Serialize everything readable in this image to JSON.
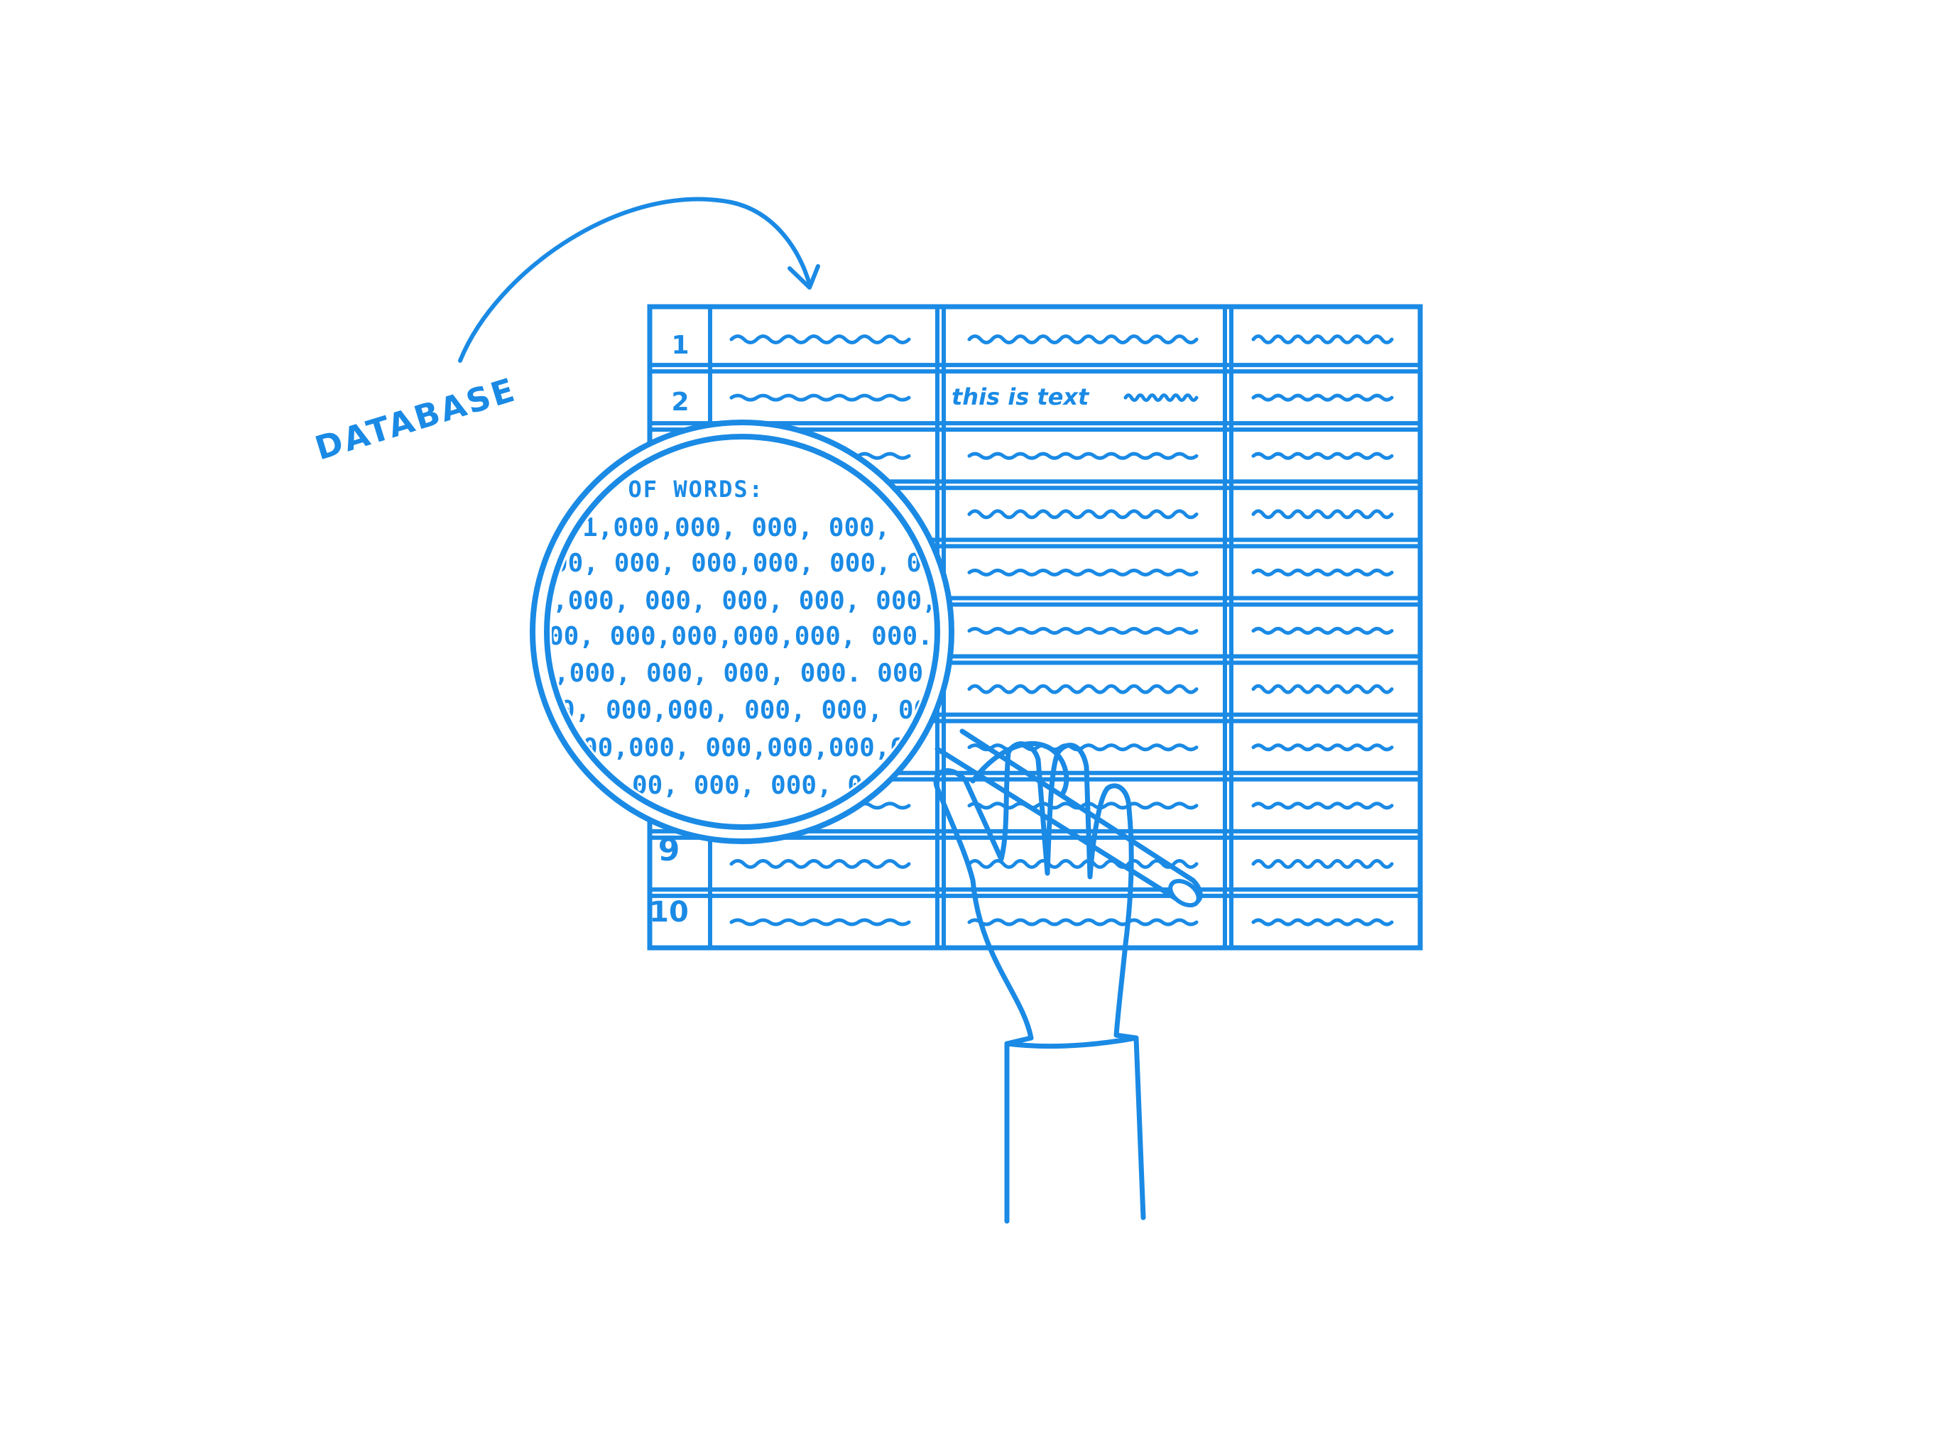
{
  "illustration": {
    "label": "DATABASE",
    "ink_color": "#1a8ae5",
    "background_color": "#ffffff"
  },
  "table": {
    "row_numbers": [
      "1",
      "2",
      "9",
      "10"
    ],
    "sample_cell_text": "this is text"
  },
  "magnifier": {
    "heading": "# OF WORDS:",
    "lines": [
      "1,000,000, 000, 000, 0",
      "00, 000, 000,000, 000, 00",
      ",000, 000, 000, 000, 000, 000,",
      "00, 000,000,000,000, 000. 0",
      ",000, 000, 000, 000. 000,00",
      "0, 000,000, 000, 000, 000,0",
      "00,000, 000,000,000,00",
      "00, 000, 000, 00"
    ]
  },
  "icons": {
    "magnifier": "magnifying-glass-icon",
    "hand": "hand-icon",
    "arrow": "curved-arrow-icon"
  }
}
